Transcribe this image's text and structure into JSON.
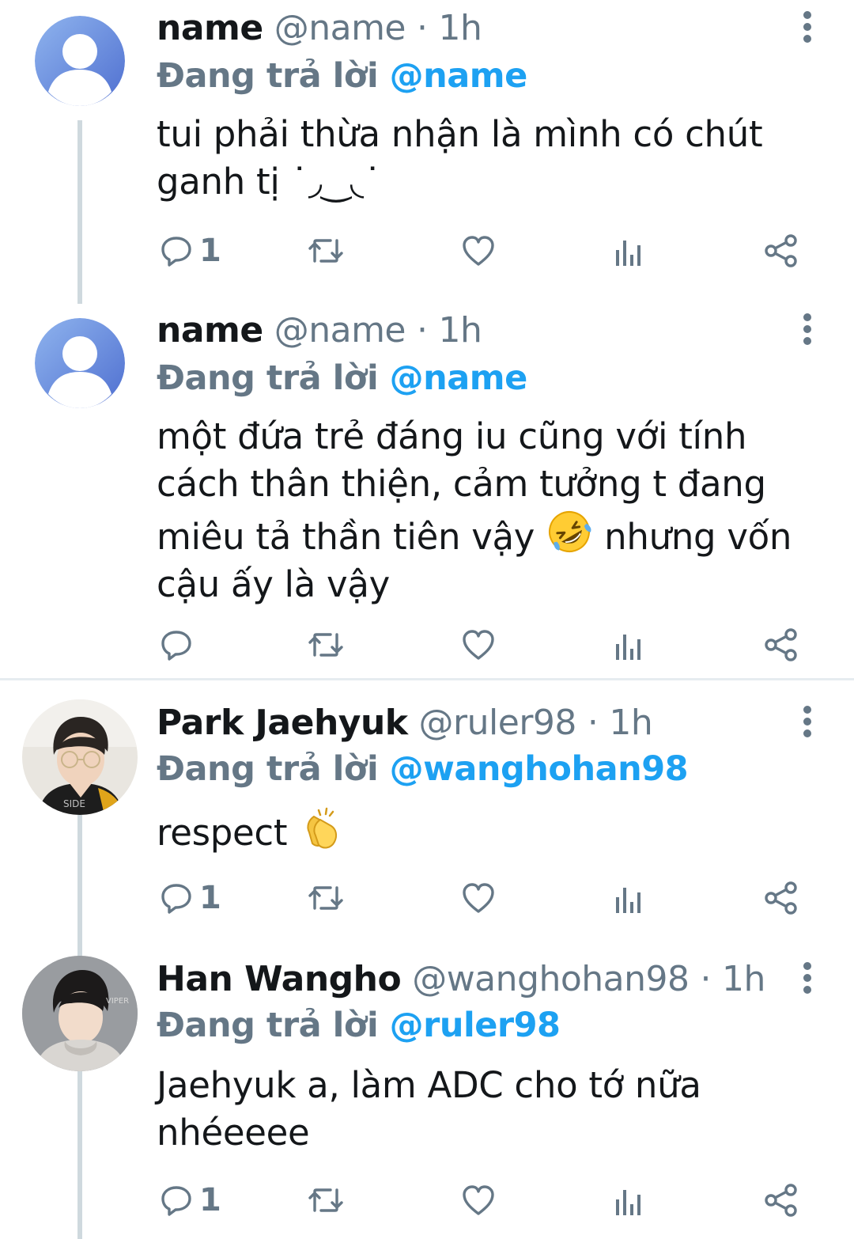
{
  "tweets": [
    {
      "display_name": "name",
      "handle": "@name",
      "separator": "·",
      "time": "1h",
      "reply_prefix": "Đang trả lời",
      "reply_handle": "@name",
      "text_lines": [
        "tui phải thừa nhận là mình có chút",
        "ganh tị ˙◞‿◟˙"
      ],
      "reply_count": "1",
      "avatar_icon": "default-avatar-icon"
    },
    {
      "display_name": "name",
      "handle": "@name",
      "separator": "·",
      "time": "1h",
      "reply_prefix": "Đang trả lời",
      "reply_handle": "@name",
      "text_lines": [
        "một đứa trẻ đáng iu cũng với tính",
        "cách thân thiện, cảm tưởng t đang",
        "miêu tả thần tiên vậy",
        "nhưng vốn",
        "cậu ấy là vậy"
      ],
      "reply_count": "",
      "avatar_icon": "default-avatar-icon"
    },
    {
      "display_name": "Park Jaehyuk",
      "handle": "@ruler98",
      "separator": "·",
      "time": "1h",
      "reply_prefix": "Đang trả lời",
      "reply_handle": "@wanghohan98",
      "text_lines": [
        "respect"
      ],
      "reply_count": "1",
      "avatar_icon": "profile-photo"
    },
    {
      "display_name": "Han Wangho",
      "handle": "@wanghohan98",
      "separator": "·",
      "time": "1h",
      "reply_prefix": "Đang trả lời",
      "reply_handle": "@ruler98",
      "text_lines": [
        "Jaehyuk a, làm ADC cho tớ nữa",
        "nhéeeee"
      ],
      "reply_count": "1",
      "avatar_icon": "profile-photo"
    }
  ],
  "icons": {
    "reply": "speech-bubble-icon",
    "retweet": "retweet-icon",
    "like": "heart-icon",
    "analytics": "bar-chart-icon",
    "share": "share-icon",
    "more": "vertical-dots-icon",
    "emoji_laugh": "rolling-on-floor-laughing-emoji",
    "emoji_clap": "clapping-hands-emoji"
  },
  "colors": {
    "accent": "#1da1f2",
    "secondary_text": "#657786",
    "primary_text": "#14171a",
    "thread_line": "#cfd9de",
    "divider": "#e6ecf0"
  }
}
